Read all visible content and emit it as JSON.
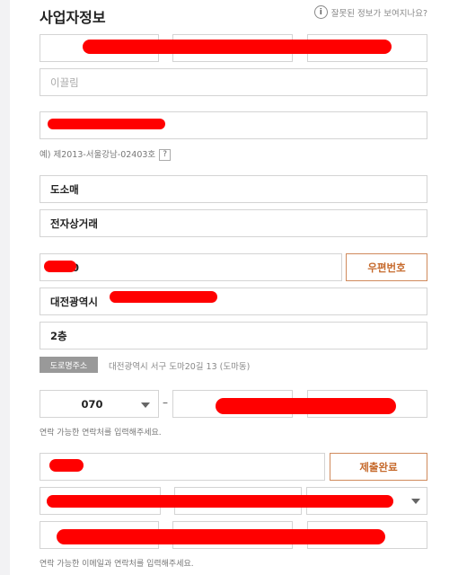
{
  "header": {
    "title": "사업자정보",
    "help_label": "잘못된 정보가 보여지나요?"
  },
  "fields": {
    "company_name_placeholder": "이끌림",
    "registration_hint": "예) 제2013-서울강남-02403호",
    "registration_help": "?",
    "business_type": "도소매",
    "business_item": "전자상거래",
    "postcode_suffix": "0",
    "postcode_button": "우편번호",
    "address_prefix": "대전광역시",
    "address_detail": "2층",
    "road_tag": "도로명주소",
    "road_address": "대전광역시 서구 도마20길 13 (도마동)",
    "phone_prefix": "070",
    "phone_dash": "–",
    "phone_hint": "연락 가능한 연락처를 입력해주세요.",
    "submit_button": "제출완료",
    "email_hint": "연락 가능한 이메일과 연락처를 입력해주세요."
  },
  "colors": {
    "accent_orange": "#c66a2c",
    "redaction": "#ff0000"
  }
}
